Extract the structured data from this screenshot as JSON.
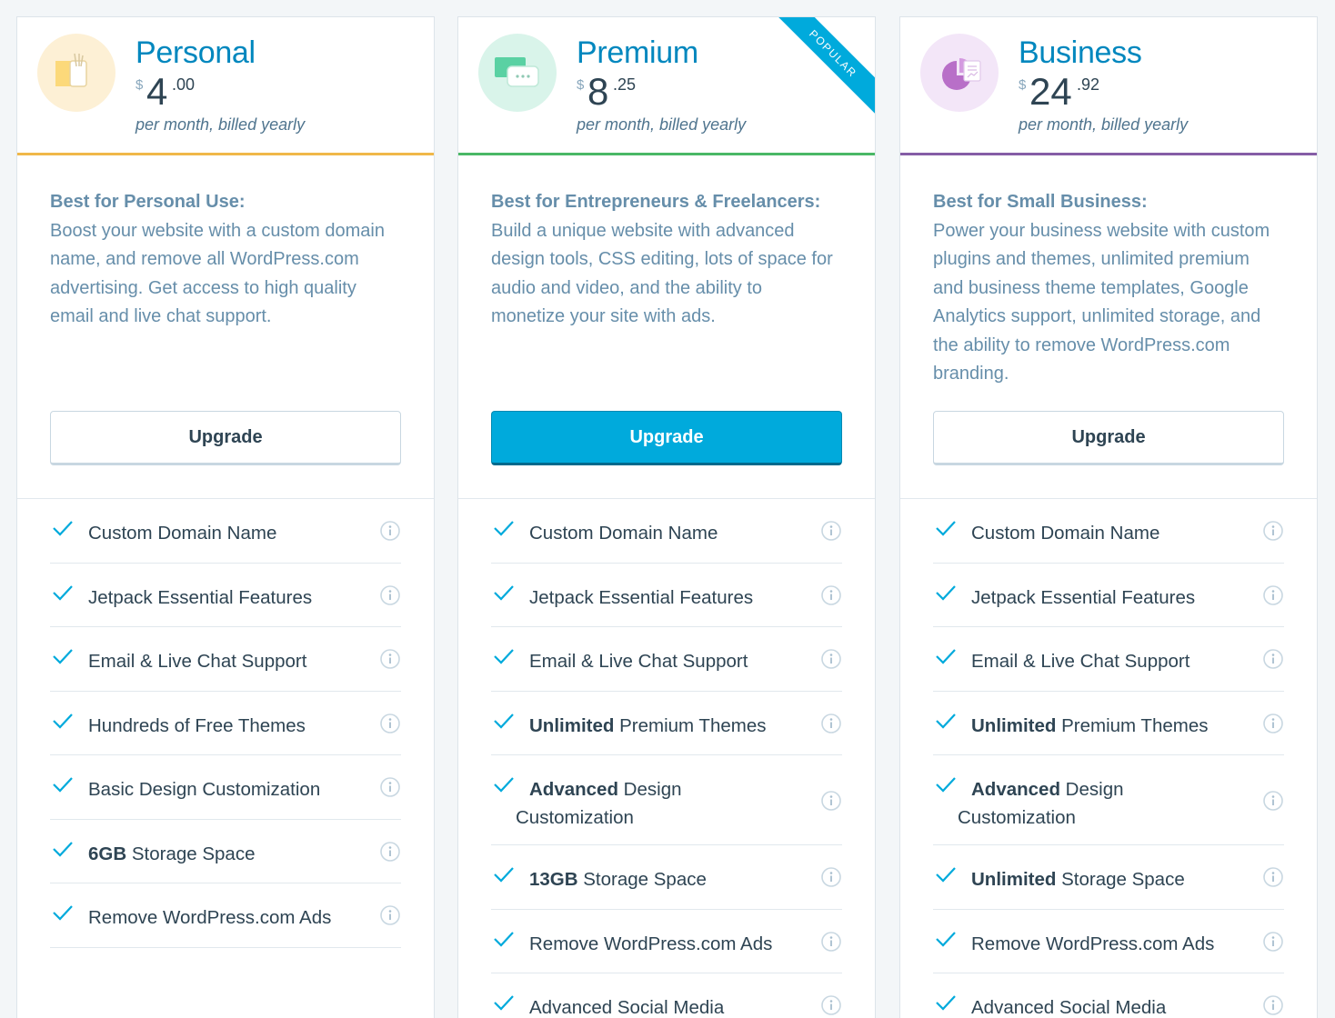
{
  "plans": [
    {
      "title": "Personal",
      "currency": "$",
      "price_int": "4",
      "price_frac": ".00",
      "billing": "per month, billed yearly",
      "accent": "#f0b849",
      "icon_bg": "#fdf0d5",
      "desc_head": "Best for Personal Use:",
      "desc_body": "Boost your website with a custom domain name, and remove all WordPress.com advertising. Get access to high quality email and live chat support.",
      "button": "Upgrade",
      "features": [
        {
          "bold": "",
          "text": "Custom Domain Name"
        },
        {
          "bold": "",
          "text": "Jetpack Essential Features"
        },
        {
          "bold": "",
          "text": "Email & Live Chat Support"
        },
        {
          "bold": "",
          "text": "Hundreds of Free Themes"
        },
        {
          "bold": "",
          "text": "Basic Design Customization"
        },
        {
          "bold": "6GB",
          "text": " Storage Space"
        },
        {
          "bold": "",
          "text": "Remove WordPress.com Ads"
        }
      ]
    },
    {
      "title": "Premium",
      "currency": "$",
      "price_int": "8",
      "price_frac": ".25",
      "billing": "per month, billed yearly",
      "accent": "#4ab866",
      "icon_bg": "#d9f4ea",
      "ribbon": "POPULAR",
      "desc_head": "Best for Entrepreneurs & Freelancers:",
      "desc_body": "Build a unique website with advanced design tools, CSS editing, lots of space for audio and video, and the ability to monetize your site with ads.",
      "button": "Upgrade",
      "features": [
        {
          "bold": "",
          "text": "Custom Domain Name"
        },
        {
          "bold": "",
          "text": "Jetpack Essential Features"
        },
        {
          "bold": "",
          "text": "Email & Live Chat Support"
        },
        {
          "bold": "Unlimited",
          "text": " Premium Themes"
        },
        {
          "bold": "Advanced",
          "text": " Design",
          "line2": "Customization"
        },
        {
          "bold": "13GB",
          "text": " Storage Space"
        },
        {
          "bold": "",
          "text": "Remove WordPress.com Ads"
        },
        {
          "bold": "",
          "text": "Advanced Social Media"
        }
      ]
    },
    {
      "title": "Business",
      "currency": "$",
      "price_int": "24",
      "price_frac": ".92",
      "billing": "per month, billed yearly",
      "accent": "#855da6",
      "icon_bg": "#f3e6f8",
      "desc_head": "Best for Small Business:",
      "desc_body": "Power your business website with custom plugins and themes, unlimited premium and business theme templates, Google Analytics support, unlimited storage, and the ability to remove WordPress.com branding.",
      "button": "Upgrade",
      "features": [
        {
          "bold": "",
          "text": "Custom Domain Name"
        },
        {
          "bold": "",
          "text": "Jetpack Essential Features"
        },
        {
          "bold": "",
          "text": "Email & Live Chat Support"
        },
        {
          "bold": "Unlimited",
          "text": " Premium Themes"
        },
        {
          "bold": "Advanced",
          "text": " Design",
          "line2": "Customization"
        },
        {
          "bold": "Unlimited",
          "text": " Storage Space"
        },
        {
          "bold": "",
          "text": "Remove WordPress.com Ads"
        },
        {
          "bold": "",
          "text": "Advanced Social Media"
        }
      ]
    }
  ],
  "icons": {
    "check": "check-icon",
    "info": "info-icon"
  }
}
